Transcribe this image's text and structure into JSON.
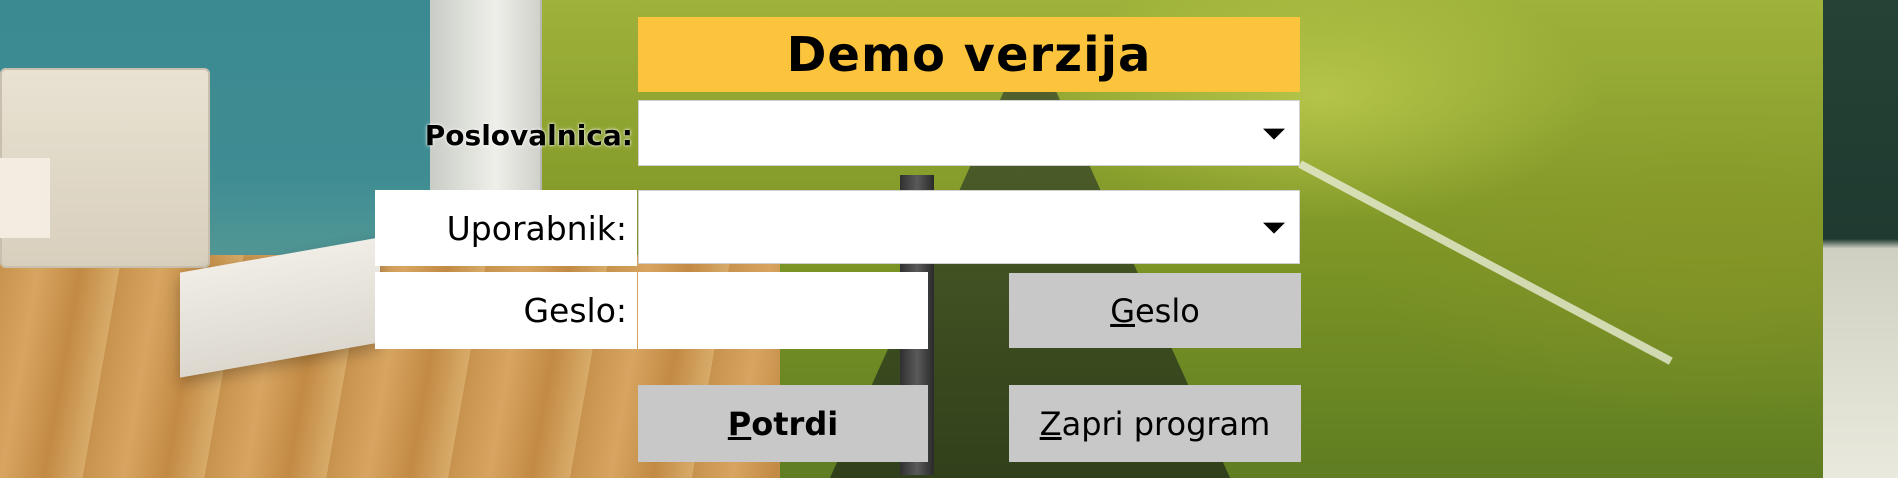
{
  "window": {
    "title": "Demo verzija"
  },
  "form": {
    "branch": {
      "label": "Poslovalnica:",
      "value": ""
    },
    "user": {
      "label": "Uporabnik:",
      "value": ""
    },
    "password": {
      "label": "Geslo:",
      "value": ""
    }
  },
  "buttons": {
    "password_button": {
      "mnemonic": "G",
      "rest": "eslo"
    },
    "confirm_button": {
      "mnemonic": "P",
      "rest": "otrdi"
    },
    "close_button": {
      "mnemonic": "Z",
      "rest": "apri program"
    }
  },
  "colors": {
    "title_background": "#fbc43c",
    "button_background": "#c8c8c8",
    "field_background": "#ffffff"
  },
  "icons": {
    "dropdown": "chevron-down-icon"
  }
}
